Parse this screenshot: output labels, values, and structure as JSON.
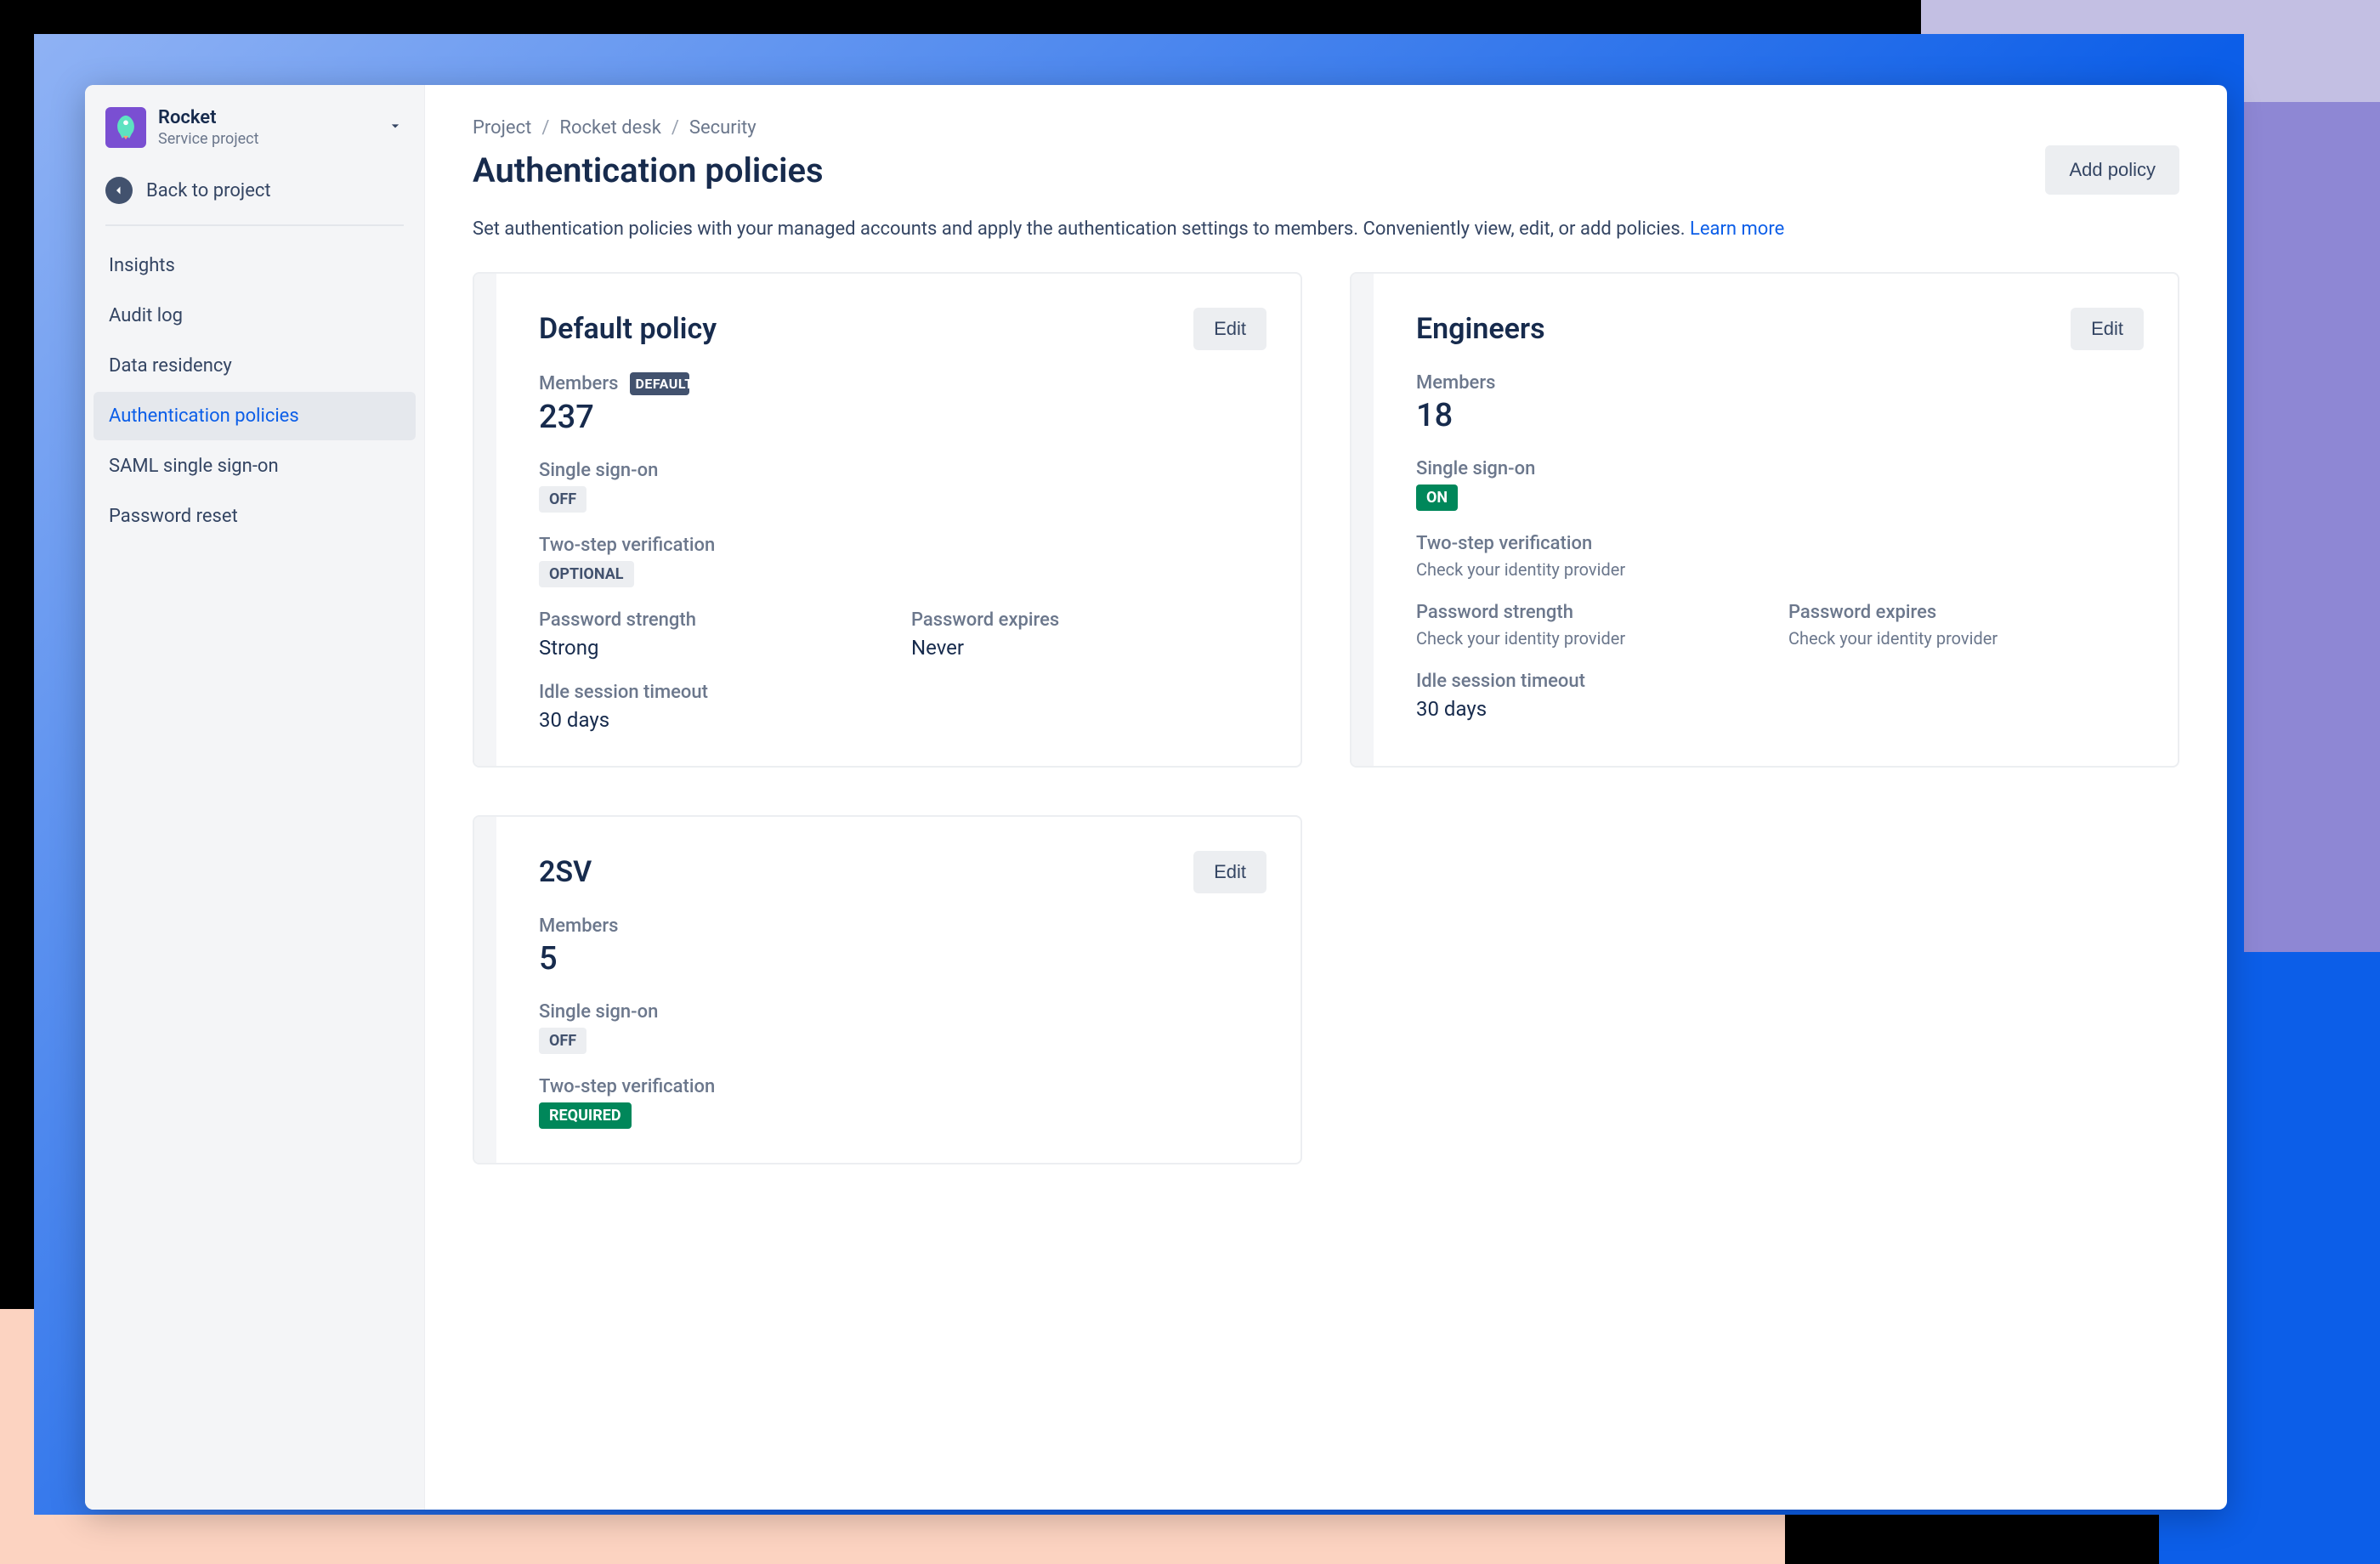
{
  "project": {
    "name": "Rocket",
    "type": "Service project",
    "back_label": "Back to project"
  },
  "sidebar": {
    "items": [
      {
        "label": "Insights"
      },
      {
        "label": "Audit log"
      },
      {
        "label": "Data residency"
      },
      {
        "label": "Authentication policies"
      },
      {
        "label": "SAML single sign-on"
      },
      {
        "label": "Password reset"
      }
    ]
  },
  "breadcrumb": {
    "items": [
      "Project",
      "Rocket desk",
      "Security"
    ]
  },
  "page": {
    "title": "Authentication policies",
    "add_button": "Add policy",
    "description": "Set authentication policies with your managed accounts and apply the authentication settings to members. Conveniently view, edit, or add policies. ",
    "learn_more": "Learn more"
  },
  "labels": {
    "members": "Members",
    "sso": "Single sign-on",
    "two_step": "Two-step verification",
    "pw_strength": "Password strength",
    "pw_expires": "Password expires",
    "idle": "Idle session timeout",
    "edit": "Edit",
    "default_badge": "DEFAULT",
    "check_idp": "Check your identity provider"
  },
  "policies": [
    {
      "name": "Default policy",
      "is_default": true,
      "members": "237",
      "sso": {
        "badge": "OFF",
        "style": "off"
      },
      "two_step": {
        "badge": "OPTIONAL",
        "style": "optional"
      },
      "pw_strength": "Strong",
      "pw_expires": "Never",
      "idle_timeout": "30 days"
    },
    {
      "name": "Engineers",
      "is_default": false,
      "members": "18",
      "sso": {
        "badge": "ON",
        "style": "on"
      },
      "two_step_note": true,
      "pw_note": true,
      "idle_timeout": "30 days"
    },
    {
      "name": "2SV",
      "is_default": false,
      "members": "5",
      "sso": {
        "badge": "OFF",
        "style": "off"
      },
      "two_step": {
        "badge": "REQUIRED",
        "style": "required"
      }
    }
  ]
}
